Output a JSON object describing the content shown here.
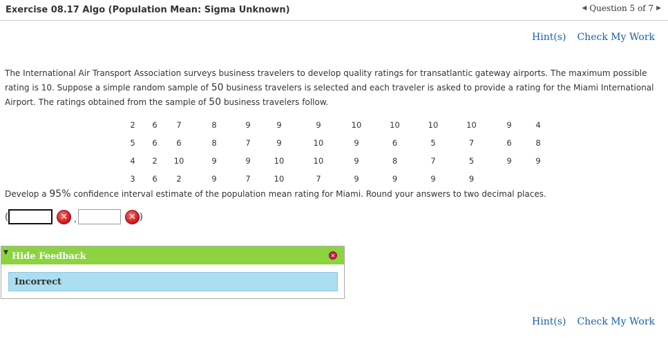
{
  "header": {
    "title": "Exercise 08.17 Algo (Population Mean: Sigma Unknown)",
    "question_nav": {
      "prev_glyph": "◀",
      "label": "Question 5 of 7",
      "next_glyph": "▶"
    }
  },
  "links": {
    "hint": "Hint(s)",
    "check": "Check My Work"
  },
  "problem": {
    "p1": "The International Air Transport Association surveys business travelers to develop quality ratings for transatlantic gateway airports. The maximum possible rating is 10. Suppose a simple random sample of ",
    "n1": "50",
    "p2": " business travelers is selected and each traveler is asked to provide a rating for the Miami International Airport. The ratings obtained from the sample of ",
    "n2": "50",
    "p3": " business travelers follow."
  },
  "ratings": [
    [
      "2",
      "6",
      "7",
      "8",
      "9",
      "9",
      "9",
      "10",
      "10",
      "10",
      "10",
      "9",
      "4"
    ],
    [
      "5",
      "6",
      "6",
      "8",
      "7",
      "9",
      "10",
      "9",
      "6",
      "5",
      "7",
      "6",
      "8"
    ],
    [
      "4",
      "2",
      "10",
      "9",
      "9",
      "10",
      "10",
      "9",
      "8",
      "7",
      "5",
      "9",
      "9"
    ],
    [
      "3",
      "6",
      "2",
      "9",
      "7",
      "10",
      "7",
      "9",
      "9",
      "9",
      "9",
      "",
      ""
    ]
  ],
  "question": {
    "q1": "Develop a ",
    "level": "95%",
    "q2": " confidence interval estimate of the population mean rating for Miami. Round your answers to two decimal places."
  },
  "answer": {
    "open_paren": "(",
    "lower_value": "",
    "comma": ",",
    "upper_value": "",
    "close_paren": ")",
    "status": "incorrect"
  },
  "feedback": {
    "toggle_label": "Hide Feedback",
    "message": "Incorrect",
    "colors": {
      "header": "#8cd43f",
      "message_bg": "#abdef0"
    }
  },
  "icons": {
    "incorrect": "x-circle-icon",
    "close": "close-circle-icon"
  }
}
